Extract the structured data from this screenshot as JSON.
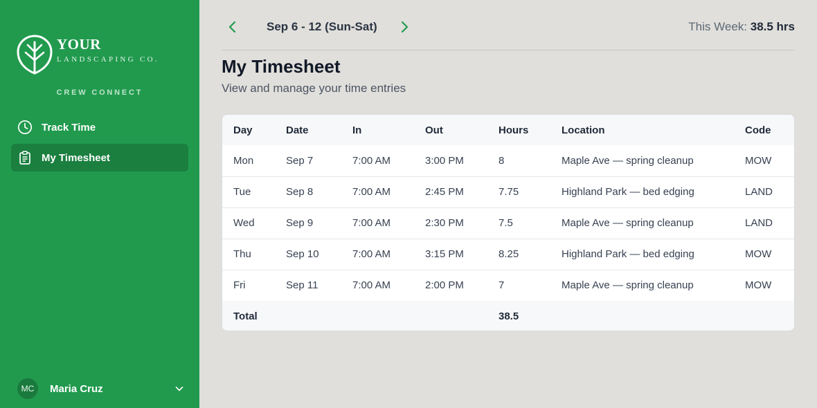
{
  "brand": {
    "name_line1": "YOUR",
    "name_line2": "LANDSCAPING CO.",
    "app_name": "CREW CONNECT"
  },
  "sidebar": {
    "items": [
      {
        "label": "Track Time",
        "icon": "clock-icon",
        "active": false
      },
      {
        "label": "My Timesheet",
        "icon": "clipboard-icon",
        "active": true
      }
    ]
  },
  "user": {
    "initials": "MC",
    "name": "Maria Cruz"
  },
  "header": {
    "week_range": "Sep 6 - 12 (Sun-Sat)",
    "this_week_label": "This Week:",
    "this_week_value": "38.5 hrs"
  },
  "page": {
    "title": "My Timesheet",
    "subtitle": "View and manage your time entries"
  },
  "table": {
    "columns": [
      "Day",
      "Date",
      "In",
      "Out",
      "Hours",
      "Location",
      "Code"
    ],
    "rows": [
      {
        "day": "Mon",
        "date": "Sep 7",
        "in": "7:00 AM",
        "out": "3:00 PM",
        "hours": "8",
        "location": "Maple Ave — spring cleanup",
        "code": "MOW"
      },
      {
        "day": "Tue",
        "date": "Sep 8",
        "in": "7:00 AM",
        "out": "2:45 PM",
        "hours": "7.75",
        "location": "Highland Park — bed edging",
        "code": "LAND"
      },
      {
        "day": "Wed",
        "date": "Sep 9",
        "in": "7:00 AM",
        "out": "2:30 PM",
        "hours": "7.5",
        "location": "Maple Ave — spring cleanup",
        "code": "LAND"
      },
      {
        "day": "Thu",
        "date": "Sep 10",
        "in": "7:00 AM",
        "out": "3:15 PM",
        "hours": "8.25",
        "location": "Highland Park — bed edging",
        "code": "MOW"
      },
      {
        "day": "Fri",
        "date": "Sep 11",
        "in": "7:00 AM",
        "out": "2:00 PM",
        "hours": "7",
        "location": "Maple Ave — spring cleanup",
        "code": "MOW"
      }
    ],
    "total_label": "Total",
    "total_hours": "38.5"
  },
  "colors": {
    "sidebar": "#219a4e",
    "sidebar_active": "#1a7f3f",
    "accent": "#219a4e",
    "background": "#e0dfdb"
  }
}
